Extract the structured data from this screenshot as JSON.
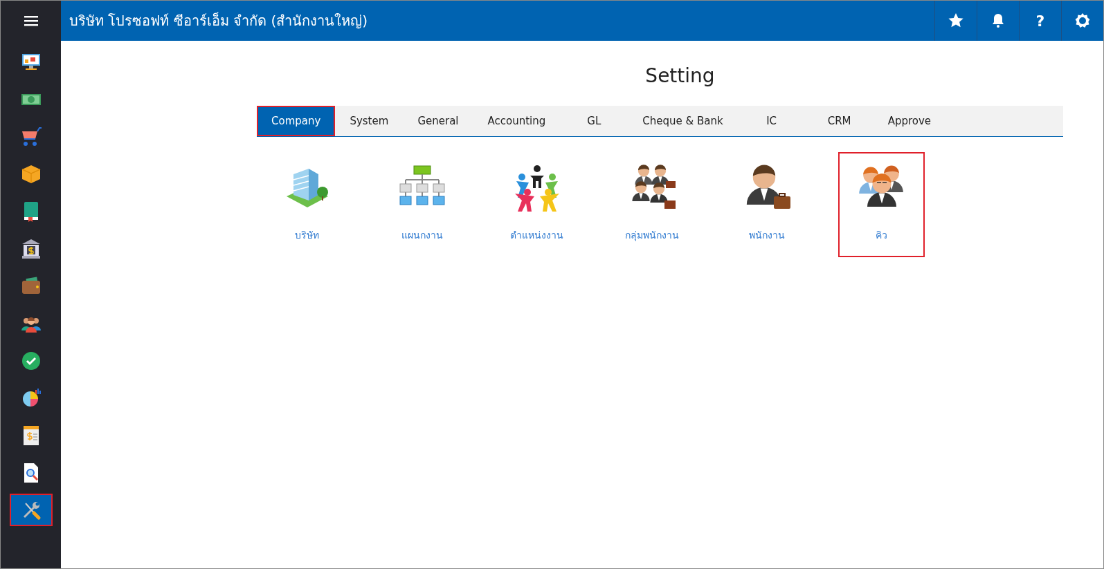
{
  "header": {
    "title": "บริษัท โปรซอฟท์ ซีอาร์เอ็ม จำกัด (สำนักงานใหญ่)",
    "help_label": "?"
  },
  "sidebar": {
    "items": [
      {
        "selected": false,
        "highlighted": false
      },
      {
        "selected": false,
        "highlighted": false
      },
      {
        "selected": false,
        "highlighted": false
      },
      {
        "selected": false,
        "highlighted": false
      },
      {
        "selected": false,
        "highlighted": false
      },
      {
        "selected": false,
        "highlighted": false
      },
      {
        "selected": false,
        "highlighted": false
      },
      {
        "selected": false,
        "highlighted": false
      },
      {
        "selected": false,
        "highlighted": false
      },
      {
        "selected": false,
        "highlighted": false
      },
      {
        "selected": false,
        "highlighted": false
      },
      {
        "selected": false,
        "highlighted": false
      },
      {
        "selected": true,
        "highlighted": true
      }
    ]
  },
  "page_title": "Setting",
  "tabs": [
    {
      "label": "Company",
      "selected": true,
      "highlighted": true
    },
    {
      "label": "System",
      "selected": false,
      "highlighted": false
    },
    {
      "label": "General",
      "selected": false,
      "highlighted": false
    },
    {
      "label": "Accounting",
      "selected": false,
      "highlighted": false
    },
    {
      "label": "GL",
      "selected": false,
      "highlighted": false
    },
    {
      "label": "Cheque & Bank",
      "selected": false,
      "highlighted": false
    },
    {
      "label": "IC",
      "selected": false,
      "highlighted": false
    },
    {
      "label": "CRM",
      "selected": false,
      "highlighted": false
    },
    {
      "label": "Approve",
      "selected": false,
      "highlighted": false
    }
  ],
  "tiles": [
    {
      "label": "บริษัท",
      "highlighted": false
    },
    {
      "label": "แผนกงาน",
      "highlighted": false
    },
    {
      "label": "ตำแหน่งงาน",
      "highlighted": false
    },
    {
      "label": "กลุ่มพนักงาน",
      "highlighted": false
    },
    {
      "label": "พนักงาน",
      "highlighted": false
    },
    {
      "label": "คิว",
      "highlighted": true
    }
  ]
}
